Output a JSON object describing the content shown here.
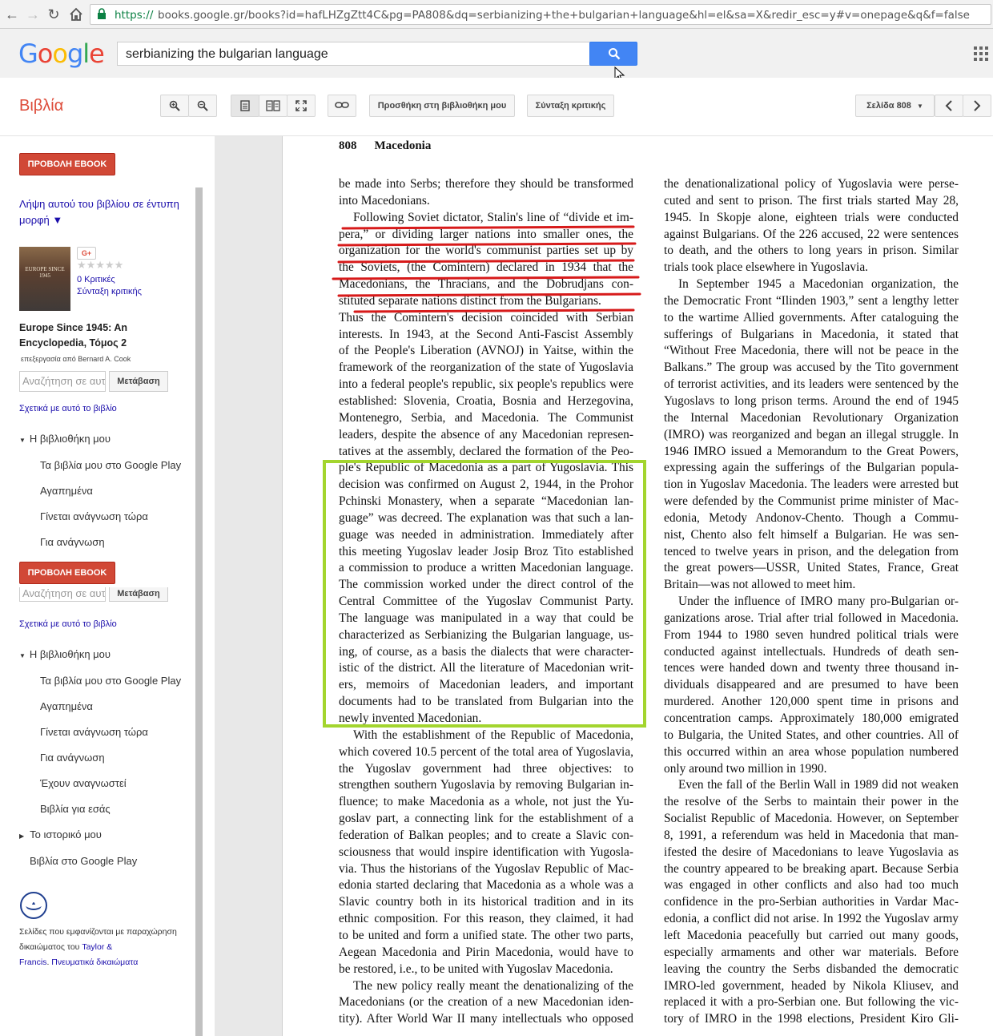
{
  "browser": {
    "url_scheme": "https://",
    "url_rest": "books.google.gr/books?id=hafLHZgZtt4C&pg=PA808&dq=serbianizing+the+bulgarian+language&hl=el&sa=X&redir_esc=y#v=onepage&q&f=false"
  },
  "google": {
    "logo": [
      "G",
      "o",
      "o",
      "g",
      "l",
      "e"
    ],
    "logo_colors": [
      "#4285f4",
      "#ea4335",
      "#fbbc05",
      "#4285f4",
      "#34a853",
      "#ea4335"
    ],
    "search_value": "serbianizing the bulgarian language"
  },
  "toolbar": {
    "title": "Βιβλία",
    "add_library": "Προσθήκη στη βιβλιοθήκη μου",
    "write_review": "Σύνταξη κριτικής",
    "page_select": "Σελίδα 808"
  },
  "sidebar": {
    "ebook_button": "ΠΡΟΒΟΛΗ EBOOK",
    "print_link_1": "Λήψη αυτού του βιβλίου σε έντυπη",
    "print_link_2": "μορφή ▼",
    "gplus": "G+",
    "stars": "★★★★★",
    "reviews": "0 Κριτικές",
    "write_review": "Σύνταξη κριτικής",
    "book_title_1": "Europe Since 1945: An",
    "book_title_2": "Encyclopedia, Τόμος 2",
    "editor": "επεξεργασία από Bernard A. Cook",
    "search_placeholder": "Αναζήτηση σε αυτό",
    "go_button": "Μετάβαση",
    "about_link": "Σχετικά με αυτό το βιβλίο",
    "my_library": "Η βιβλιοθήκη μου",
    "library_items": [
      "Τα βιβλία μου στο Google Play",
      "Αγαπημένα",
      "Γίνεται ανάγνωση τώρα",
      "Για ανάγνωση"
    ],
    "library_items_full": [
      "Τα βιβλία μου στο Google Play",
      "Αγαπημένα",
      "Γίνεται ανάγνωση τώρα",
      "Για ανάγνωση",
      "Έχουν αναγνωστεί",
      "Βιβλία για εσάς"
    ],
    "history": "Το ιστορικό μου",
    "books_play": "Βιβλία στο Google Play",
    "copyright_1": "Σελίδες που εμφανίζονται με παραχώρηση",
    "copyright_2": "δικαιώματος του",
    "copyright_publisher_1": "Taylor &",
    "copyright_publisher_2": "Francis",
    "copyright_rights": "Πνευματικά δικαιώματα",
    "cover_title": "EUROPE SINCE 1945"
  },
  "page": {
    "number": "808",
    "running_head": "Macedonia",
    "col1_lines": [
      "be made into Serbs; therefore they should be transformed",
      "into Macedonians.",
      "Following Soviet dictator, Stalin's line of “divide et im-",
      "pera,” or dividing larger nations into smaller ones, the",
      "organization for the world's communist parties set up by",
      "the Soviets, (the Comintern) declared in 1934 that the",
      "Macedonians, the Thracians, and the Dobrudjans con-",
      "stituted separate nations distinct from the Bulgarians.",
      "Thus the Comintern's decision coincided with Serbian",
      "interests. In 1943, at the Second Anti-Fascist Assembly",
      "of the People's Liberation (AVNOJ) in Yaitse, within the",
      "framework of the reorganization of the state of Yugoslavia",
      "into a federal people's republic, six people's republics were",
      "established: Slovenia, Croatia, Bosnia and Herzegovina,",
      "Montenegro, Serbia, and Macedonia. The Communist",
      "leaders, despite the absence of any Macedonian represen-",
      "tatives at the assembly, declared the formation of the Peo-",
      "ple's Republic of Macedonia as a part of Yugoslavia. This",
      "decision was confirmed on August 2, 1944, in the Prohor",
      "Pchinski Monastery, when a separate “Macedonian lan-",
      "guage” was decreed. The explanation was that such a lan-",
      "guage was needed in administration. Immediately after",
      "this meeting Yugoslav leader Josip Broz Tito established",
      "a commission to produce a written Macedonian language.",
      "The commission worked under the direct control of the",
      "Central Committee of the Yugoslav Communist Party.",
      "The language was manipulated in a way that could be",
      "characterized as Serbianizing the Bulgarian language, us-",
      "ing, of course, as a basis the dialects that were character-",
      "istic of the district. All the literature of Macedonian writ-",
      "ers, memoirs of Macedonian leaders, and important",
      "documents had to be translated from Bulgarian into the",
      "newly invented Macedonian.",
      "With the establishment of the Republic of Macedonia,",
      "which covered 10.5 percent of the total area of Yugoslavia,",
      "the Yugoslav government had three objectives: to",
      "strengthen southern Yugoslavia by removing Bulgarian in-",
      "fluence; to make Macedonia as a whole, not just the Yu-",
      "goslav part, a connecting link for the establishment of a",
      "federation of Balkan peoples; and to create a Slavic con-",
      "sciousness that would inspire identification with Yugosla-",
      "via. Thus the historians of the Yugoslav Republic of Mac-",
      "edonia started declaring that Macedonia as a whole was a",
      "Slavic country both in its historical tradition and in its",
      "ethnic composition. For this reason, they claimed, it had",
      "to be united and form a unified state. The other two parts,",
      "Aegean Macedonia and Pirin Macedonia, would have to",
      "be restored, i.e., to be united with Yugoslav Macedonia.",
      "The new policy really meant the denationalizing of the",
      "Macedonians (or the creation of a new Macedonian iden-",
      "tity). After World War II many intellectuals who opposed"
    ],
    "col2_lines": [
      "the denationalizational policy of Yugoslavia were perse-",
      "cuted and sent to prison. The first trials started May 28,",
      "1945. In Skopje alone, eighteen trials were conducted",
      "against Bulgarians. Of the 226 accused, 22 were sentences",
      "to death, and the others to long years in prison. Similar",
      "trials took place elsewhere in Yugoslavia.",
      "In September 1945 a Macedonian organization, the",
      "the Democratic Front “Ilinden 1903,” sent a lengthy letter",
      "to the wartime Allied governments. After cataloguing the",
      "sufferings of Bulgarians in Macedonia, it stated that",
      "“Without Free Macedonia, there will not be peace in the",
      "Balkans.” The group was accused by the Tito government",
      "of terrorist activities, and its leaders were sentenced by the",
      "Yugoslavs to long prison terms. Around the end of 1945",
      "the Internal Macedonian Revolutionary Organization",
      "(IMRO) was reorganized and began an illegal struggle. In",
      "1946 IMRO issued a Memorandum to the Great Powers,",
      "expressing again the sufferings of the Bulgarian popula-",
      "tion in Yugoslav Macedonia. The leaders were arrested but",
      "were defended by the Communist prime minister of Mac-",
      "edonia, Metody Andonov-Chento. Though a Commu-",
      "nist, Chento also felt himself a Bulgarian. He was sen-",
      "tenced to twelve years in prison, and the delegation from",
      "the great powers—USSR, United States, France, Great",
      "Britain—was not allowed to meet him.",
      "Under the influence of IMRO many pro-Bulgarian or-",
      "ganizations arose. Trial after trial followed in Macedonia.",
      "From 1944 to 1980 seven hundred political trials were",
      "conducted against intellectuals. Hundreds of death sen-",
      "tences were handed down and twenty three thousand in-",
      "dividuals disappeared and are presumed to have been",
      "murdered. Another 120,000 spent time in prisons and",
      "concentration camps. Approximately 180,000 emigrated",
      "to Bulgaria, the United States, and other countries. All of",
      "this occurred within an area whose population numbered",
      "only around two million in 1990.",
      "Even the fall of the Berlin Wall in 1989 did not weaken",
      "the resolve of the Serbs to maintain their power in the",
      "Socialist Republic of Macedonia. However, on September",
      "8, 1991, a referendum was held in Macedonia that man-",
      "ifested the desire of Macedonians to leave Yugoslavia as",
      "the country appeared to be breaking apart. Because Serbia",
      "was engaged in other conflicts and also had too much",
      "confidence in the pro-Serbian authorities in Vardar Mac-",
      "edonia, a conflict did not arise. In 1992 the Yugoslav army",
      "left Macedonia peacefully but carried out many goods,",
      "especially armaments and other war materials. Before",
      "leaving the country the Serbs disbanded the democratic",
      "IMRO-led government, headed by Nikola Kliusev, and",
      "replaced it with a pro-Serbian one. But following the vic-",
      "tory of IMRO in the 1998 elections, President Kiro Gli-"
    ],
    "col1_indent_lines": [
      2,
      33,
      48
    ],
    "col2_indent_lines": [
      6,
      25,
      36
    ],
    "col1_last_lines": [
      1,
      7,
      32,
      47
    ],
    "col2_last_lines": [
      5,
      24,
      35
    ],
    "annotation_colors": {
      "underline": "#d71a1a",
      "box": "#a3d52e"
    }
  }
}
